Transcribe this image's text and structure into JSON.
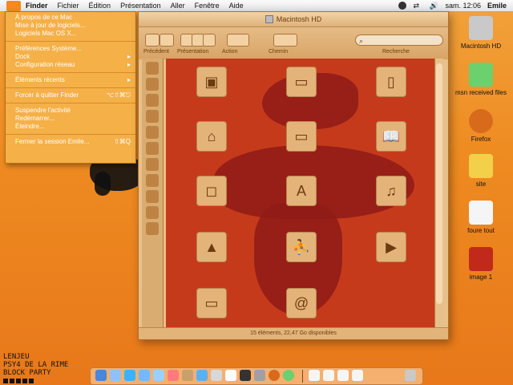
{
  "menubar": {
    "apple": "apple-logo",
    "items": [
      "Finder",
      "Fichier",
      "Édition",
      "Présentation",
      "Aller",
      "Fenêtre",
      "Aide"
    ],
    "clock": "sam. 12:06",
    "user": "Emile",
    "status_icons": [
      "spotlight-icon",
      "network-arrows-icon",
      "volume-icon"
    ]
  },
  "apple_menu": {
    "items": [
      {
        "label": "À propos de ce Mac",
        "shortcut": "",
        "has_submenu": false
      },
      {
        "label": "Mise à jour de logiciels...",
        "shortcut": "",
        "has_submenu": false
      },
      {
        "label": "Logiciels Mac OS X...",
        "shortcut": "",
        "has_submenu": false
      },
      {
        "label": "Préférences Système...",
        "shortcut": "",
        "has_submenu": false
      },
      {
        "label": "Dock",
        "shortcut": "",
        "has_submenu": true
      },
      {
        "label": "Configuration réseau",
        "shortcut": "",
        "has_submenu": true
      },
      {
        "label": "Éléments récents",
        "shortcut": "",
        "has_submenu": true
      },
      {
        "label": "Forcer à quitter Finder",
        "shortcut": "⌥⇧⌘⎋",
        "has_submenu": false
      },
      {
        "label": "Suspendre l'activité",
        "shortcut": "",
        "has_submenu": false
      },
      {
        "label": "Redémarrer...",
        "shortcut": "",
        "has_submenu": false
      },
      {
        "label": "Éteindre...",
        "shortcut": "",
        "has_submenu": false
      },
      {
        "label": "Fermer la session Emile...",
        "shortcut": "⇧⌘Q",
        "has_submenu": false
      }
    ]
  },
  "finder": {
    "title": "Macintosh HD",
    "toolbar": {
      "labels": [
        "Précédent",
        "Présentation",
        "Action",
        "Chemin",
        "Recherche"
      ]
    },
    "status": "15 éléments, 22,47 Go disponibles"
  },
  "desktop": {
    "icons": [
      {
        "label": "Macintosh HD",
        "icon": "hard-drive-icon",
        "color": "#c9c9c9"
      },
      {
        "label": "msn received files",
        "icon": "folder-icon",
        "color": "#6bd06e"
      },
      {
        "label": "Firefox",
        "icon": "firefox-icon",
        "color": "#d86b1b"
      },
      {
        "label": "site",
        "icon": "folder-icon",
        "color": "#f2d04a"
      },
      {
        "label": "foure tout",
        "icon": "folder-icon",
        "color": "#f5f5f5"
      },
      {
        "label": "image 1",
        "icon": "image-icon",
        "color": "#c12a1a"
      }
    ],
    "corner_text": [
      "LENJEU",
      "PSY4 DE LA RIME",
      "BLOCK PARTY"
    ]
  },
  "colors": {
    "accent": "#f48a1c",
    "window": "#e8c08a",
    "content": "#c63a1c",
    "dropdown": "#f5b048"
  }
}
